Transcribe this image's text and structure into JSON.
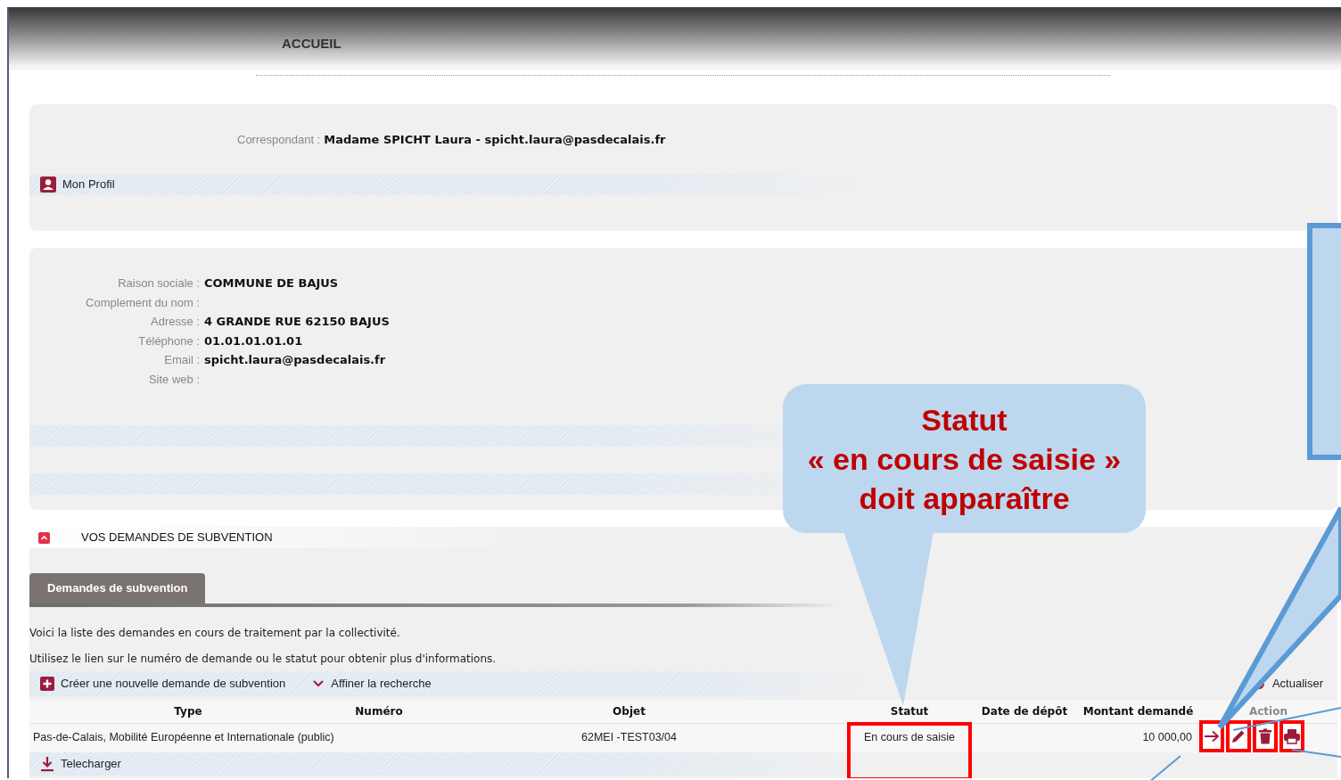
{
  "header": {
    "title": "ACCUEIL"
  },
  "correspondent": {
    "label": "Correspondant :",
    "value": "Madame SPICHT Laura - spicht.laura@pasdecalais.fr",
    "profile_link": "Mon Profil"
  },
  "organisation": {
    "fields": [
      {
        "label": "Raison sociale :",
        "value": "COMMUNE DE BAJUS"
      },
      {
        "label": "Complement du nom :"
      },
      {
        "label": "Adresse :",
        "value": "4 GRANDE RUE 62150 BAJUS"
      },
      {
        "label": "Téléphone :",
        "value": "01.01.01.01.01"
      },
      {
        "label": "Email :",
        "value": "spicht.laura@pasdecalais.fr"
      },
      {
        "label": "Site web :"
      }
    ]
  },
  "requests": {
    "title": "VOS DEMANDES DE SUBVENTION",
    "tabs": [
      {
        "label": "Demandes de subvention",
        "selected": true
      }
    ],
    "intro": [
      "Voici la liste des demandes en cours de traitement par la collectivité.",
      "Utilisez le lien sur le numéro de demande ou le statut pour obtenir plus d'informations."
    ],
    "toolbar": {
      "create": "Créer une nouvelle demande de subvention",
      "filter": "Affiner la recherche",
      "refresh": "Actualiser"
    },
    "table": {
      "columns": [
        {
          "label": "Type",
          "muted": false
        },
        {
          "label": "Numéro",
          "muted": false
        },
        {
          "label": "Objet",
          "muted": false
        },
        {
          "label": "Statut",
          "muted": false
        },
        {
          "label": "Date de dépôt",
          "muted": false
        },
        {
          "label": "Montant demandé",
          "muted": false
        },
        {
          "label": "Action",
          "muted": true
        }
      ],
      "rows": [
        {
          "type": "Pas-de-Calais, Mobilité Européenne et Internationale (public)",
          "objet": "62MEI -TEST03/04",
          "statut": "En cours de saisie",
          "statut_highlighted": true,
          "montant": "10 000,00",
          "actions": [
            {
              "kind": "open",
              "highlighted": true
            },
            {
              "kind": "edit",
              "highlighted": true
            },
            {
              "kind": "delete",
              "highlighted": true
            },
            {
              "kind": "print",
              "highlighted": true
            }
          ]
        }
      ]
    },
    "download": "Telecharger"
  },
  "annotation": {
    "lines": [
      "Statut",
      "« en cours de saisie »",
      "doit apparaître"
    ]
  }
}
